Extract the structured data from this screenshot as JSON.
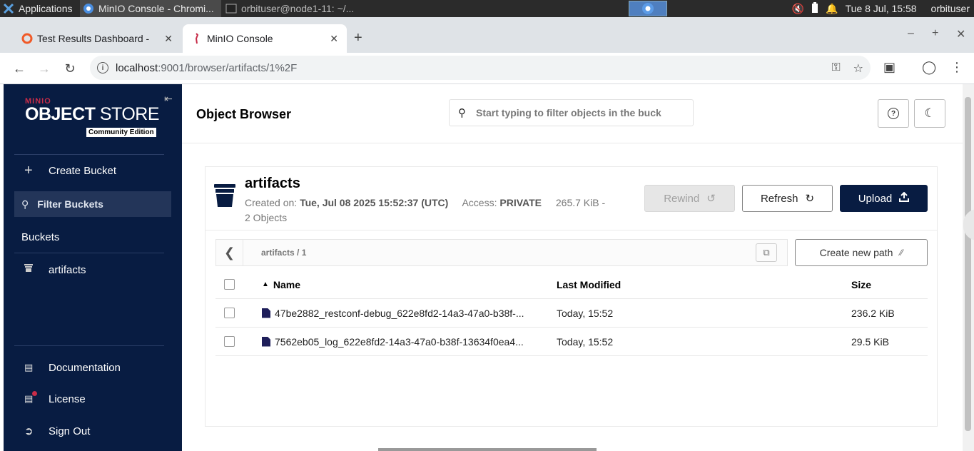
{
  "taskbar": {
    "apps_label": "Applications",
    "window1": "MinIO Console - Chromi...",
    "window2": "orbituser@node1-11: ~/...",
    "clock": "Tue  8 Jul, 15:58",
    "user": "orbituser"
  },
  "browser": {
    "tabs": [
      {
        "title": "Test Results Dashboard - ",
        "active": false
      },
      {
        "title": "MinIO Console",
        "active": true
      }
    ],
    "url_host": "localhost",
    "url_path": ":9001/browser/artifacts/1%2F"
  },
  "sidebar": {
    "logo_brand": "MINIO",
    "logo_object": "OBJECT",
    "logo_store": "STORE",
    "logo_edition": "Community Edition",
    "create_bucket": "Create Bucket",
    "filter_buckets": "Filter Buckets",
    "buckets_header": "Buckets",
    "buckets": [
      "artifacts"
    ],
    "documentation": "Documentation",
    "license": "License",
    "sign_out": "Sign Out"
  },
  "header": {
    "title": "Object Browser",
    "search_placeholder": "Start typing to filter objects in the buck"
  },
  "bucket": {
    "name": "artifacts",
    "created_label": "Created on:",
    "created_value": "Tue, Jul 08 2025 15:52:37 (UTC)",
    "access_label": "Access:",
    "access_value": "PRIVATE",
    "size": "265.7 KiB -",
    "objects": "2 Objects",
    "rewind": "Rewind",
    "refresh": "Refresh",
    "upload": "Upload"
  },
  "path": {
    "crumb": "artifacts  /  1",
    "create_new_path": "Create new path"
  },
  "table": {
    "headers": {
      "name": "Name",
      "modified": "Last Modified",
      "size": "Size"
    },
    "rows": [
      {
        "name": "47be2882_restconf-debug_622e8fd2-14a3-47a0-b38f-...",
        "modified": "Today, 15:52",
        "size": "236.2 KiB"
      },
      {
        "name": "7562eb05_log_622e8fd2-14a3-47a0-b38f-13634f0ea4...",
        "modified": "Today, 15:52",
        "size": "29.5 KiB"
      }
    ]
  }
}
